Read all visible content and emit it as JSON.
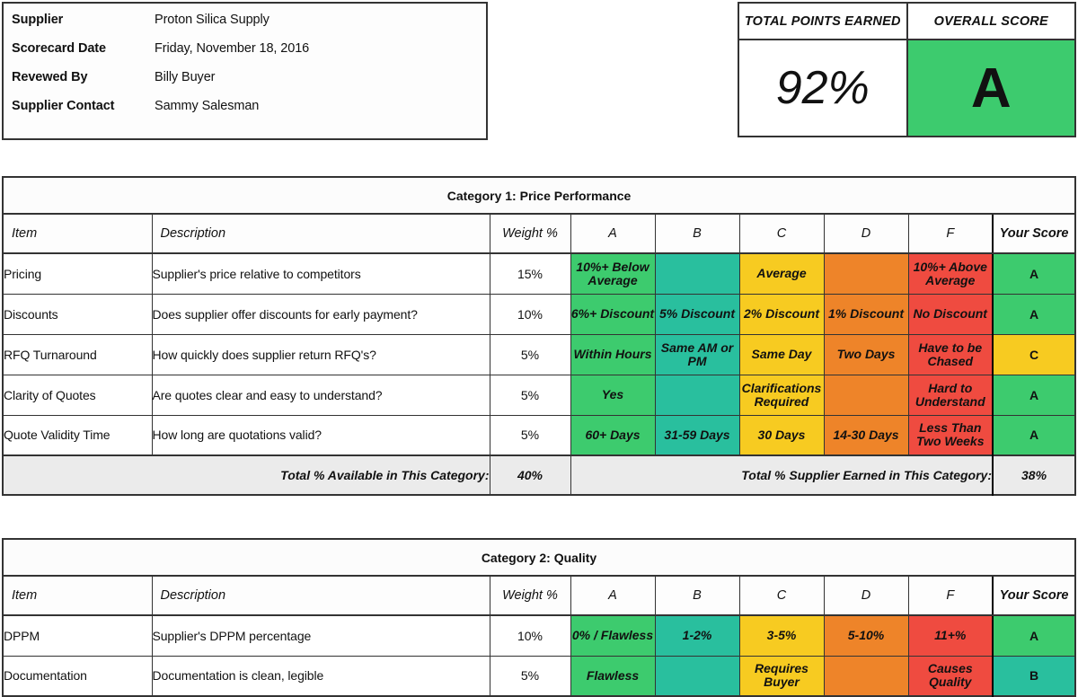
{
  "supplier_info": {
    "rows": [
      {
        "label": "Supplier",
        "value": "Proton Silica Supply"
      },
      {
        "label": "Scorecard Date",
        "value": "Friday, November 18, 2016"
      },
      {
        "label": "Revewed By",
        "value": "Billy Buyer"
      },
      {
        "label": "Supplier Contact",
        "value": "Sammy Salesman"
      }
    ]
  },
  "score_summary": {
    "points_label": "TOTAL POINTS EARNED",
    "score_label": "OVERALL SCORE",
    "points_value": "92%",
    "grade_value": "A",
    "grade_color": "#3DCB6E"
  },
  "grade_colors": {
    "A": "#3DCB6E",
    "B": "#29BF9E",
    "C": "#F7CB21",
    "D": "#EE8429",
    "F": "#EF4B40"
  },
  "column_headers": {
    "item": "Item",
    "description": "Description",
    "weight": "Weight %",
    "a": "A",
    "b": "B",
    "c": "C",
    "d": "D",
    "f": "F",
    "your_score": "Your Score"
  },
  "categories": [
    {
      "title": "Category 1: Price Performance",
      "rows": [
        {
          "item": "Pricing",
          "description": "Supplier's price relative to competitors",
          "weight": "15%",
          "a": "10%+ Below Average",
          "b": "",
          "c": "Average",
          "d": "",
          "f": "10%+ Above Average",
          "your_score": "A"
        },
        {
          "item": "Discounts",
          "description": "Does supplier offer discounts for early payment?",
          "weight": "10%",
          "a": "6%+ Discount",
          "b": "5% Discount",
          "c": "2% Discount",
          "d": "1% Discount",
          "f": "No Discount",
          "your_score": "A"
        },
        {
          "item": "RFQ Turnaround",
          "description": "How quickly does supplier return RFQ's?",
          "weight": "5%",
          "a": "Within Hours",
          "b": "Same AM or PM",
          "c": "Same Day",
          "d": "Two Days",
          "f": "Have to be Chased",
          "your_score": "C"
        },
        {
          "item": "Clarity of Quotes",
          "description": "Are quotes clear and easy to understand?",
          "weight": "5%",
          "a": "Yes",
          "b": "",
          "c": "Clarifications Required",
          "d": "",
          "f": "Hard to Understand",
          "your_score": "A"
        },
        {
          "item": "Quote Validity Time",
          "description": "How long are quotations valid?",
          "weight": "5%",
          "a": "60+ Days",
          "b": "31-59 Days",
          "c": "30 Days",
          "d": "14-30 Days",
          "f": "Less Than Two Weeks",
          "your_score": "A"
        }
      ],
      "total_available_label": "Total % Available in This Category:",
      "total_available_value": "40%",
      "total_earned_label": "Total % Supplier Earned in This Category:",
      "total_earned_value": "38%"
    },
    {
      "title": "Category 2: Quality",
      "rows": [
        {
          "item": "DPPM",
          "description": "Supplier's DPPM percentage",
          "weight": "10%",
          "a": "0% / Flawless",
          "b": "1-2%",
          "c": "3-5%",
          "d": "5-10%",
          "f": "11+%",
          "your_score": "A"
        },
        {
          "item": "Documentation",
          "description": "Documentation is clean, legible",
          "weight": "5%",
          "a": "Flawless",
          "b": "",
          "c": "Requires Buyer",
          "d": "",
          "f": "Causes Quality",
          "your_score": "B"
        }
      ]
    }
  ]
}
